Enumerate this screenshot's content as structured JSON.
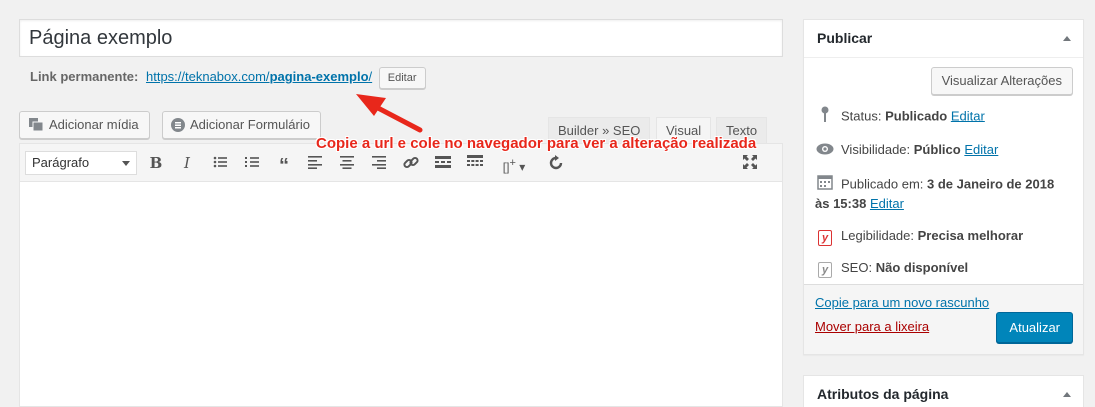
{
  "title": {
    "value": "Página exemplo"
  },
  "permalink": {
    "label": "Link permanente:",
    "base": "https://teknabox.com/",
    "slug": "pagina-exemplo",
    "trail": "/",
    "edit_label": "Editar"
  },
  "media_buttons": [
    {
      "label": "Adicionar mídia",
      "icon": "media-icon"
    },
    {
      "label": "Adicionar Formulário",
      "icon": "form-icon"
    }
  ],
  "tabs": [
    {
      "label": "Builder » SEO"
    },
    {
      "label": "Visual",
      "active": true
    },
    {
      "label": "Texto"
    }
  ],
  "toolbar": {
    "format_select": "Parágrafo",
    "icons": [
      "bold-icon",
      "italic-icon",
      "bulleted-list-icon",
      "numbered-list-icon",
      "blockquote-icon",
      "align-left-icon",
      "align-center-icon",
      "align-right-icon",
      "link-icon",
      "read-more-icon",
      "toolbar-toggle-icon",
      "shortcode-icon",
      "refresh-icon",
      "fullscreen-icon"
    ]
  },
  "annotation": {
    "text": "Copie a url e cole no navegador para ver a alteração realizada",
    "color": "#e8271b"
  },
  "publish": {
    "heading": "Publicar",
    "preview_label": "Visualizar Alterações",
    "status_label": "Status:",
    "status_value": "Publicado",
    "visibility_label": "Visibilidade:",
    "visibility_value": "Público",
    "published_label": "Publicado em:",
    "published_date": "3 de Janeiro de 2018",
    "published_time": "às 15:38",
    "edit_label": "Editar",
    "readability_label": "Legibilidade:",
    "readability_value": "Precisa melhorar",
    "seo_label": "SEO:",
    "seo_value": "Não disponível",
    "copy_label": "Copie para um novo rascunho",
    "trash_label": "Mover para a lixeira",
    "update_label": "Atualizar"
  },
  "attributes": {
    "heading": "Atributos da página"
  },
  "colors": {
    "accent": "#0085ba",
    "link": "#0073aa",
    "trash": "#a00",
    "annotation": "#e8271b",
    "yoast_bad": "#dc3232"
  }
}
